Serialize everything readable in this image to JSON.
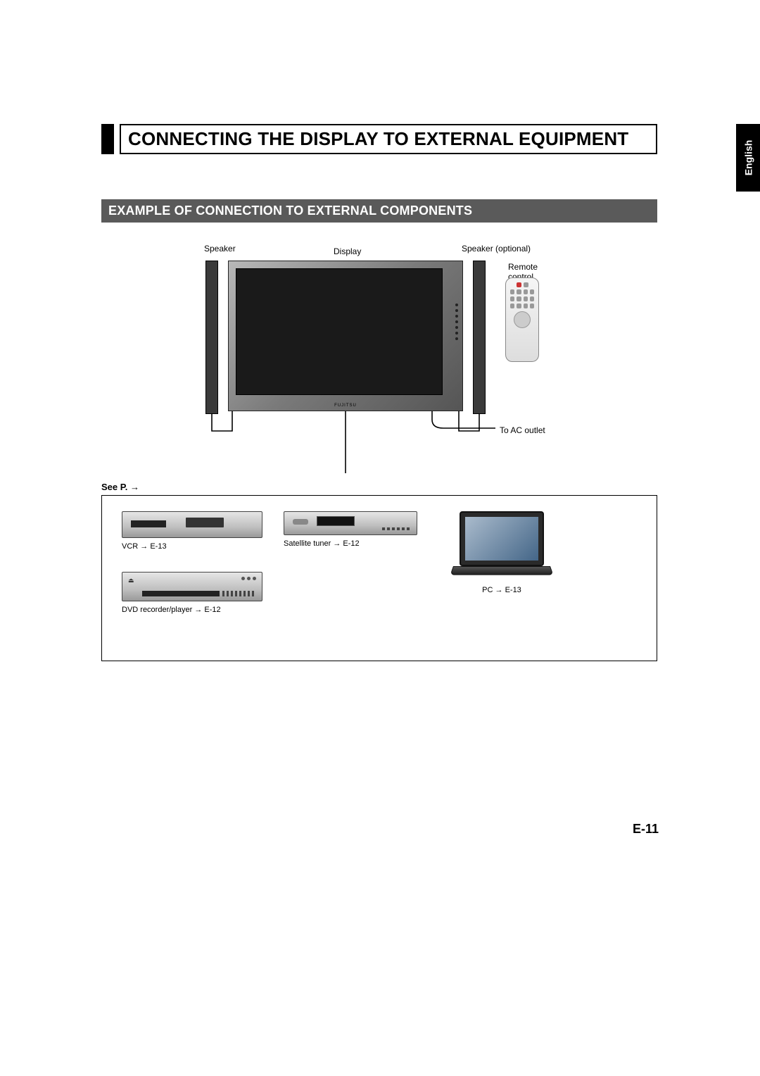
{
  "language_tab": "English",
  "title": "CONNECTING THE DISPLAY TO EXTERNAL EQUIPMENT",
  "subheading": "EXAMPLE OF CONNECTION TO EXTERNAL COMPONENTS",
  "labels": {
    "speaker": "Speaker",
    "display": "Display",
    "speaker_optional": "Speaker (optional)",
    "remote_control": "Remote\ncontrol",
    "to_ac_outlet": "To AC outlet",
    "display_brand": "FUJITSU"
  },
  "see_p": "See P. →",
  "devices": {
    "vcr": "VCR → E-13",
    "satellite": "Satellite tuner → E-12",
    "dvd": "DVD recorder/player → E-12",
    "pc": "PC → E-13"
  },
  "page_number": "E-11"
}
